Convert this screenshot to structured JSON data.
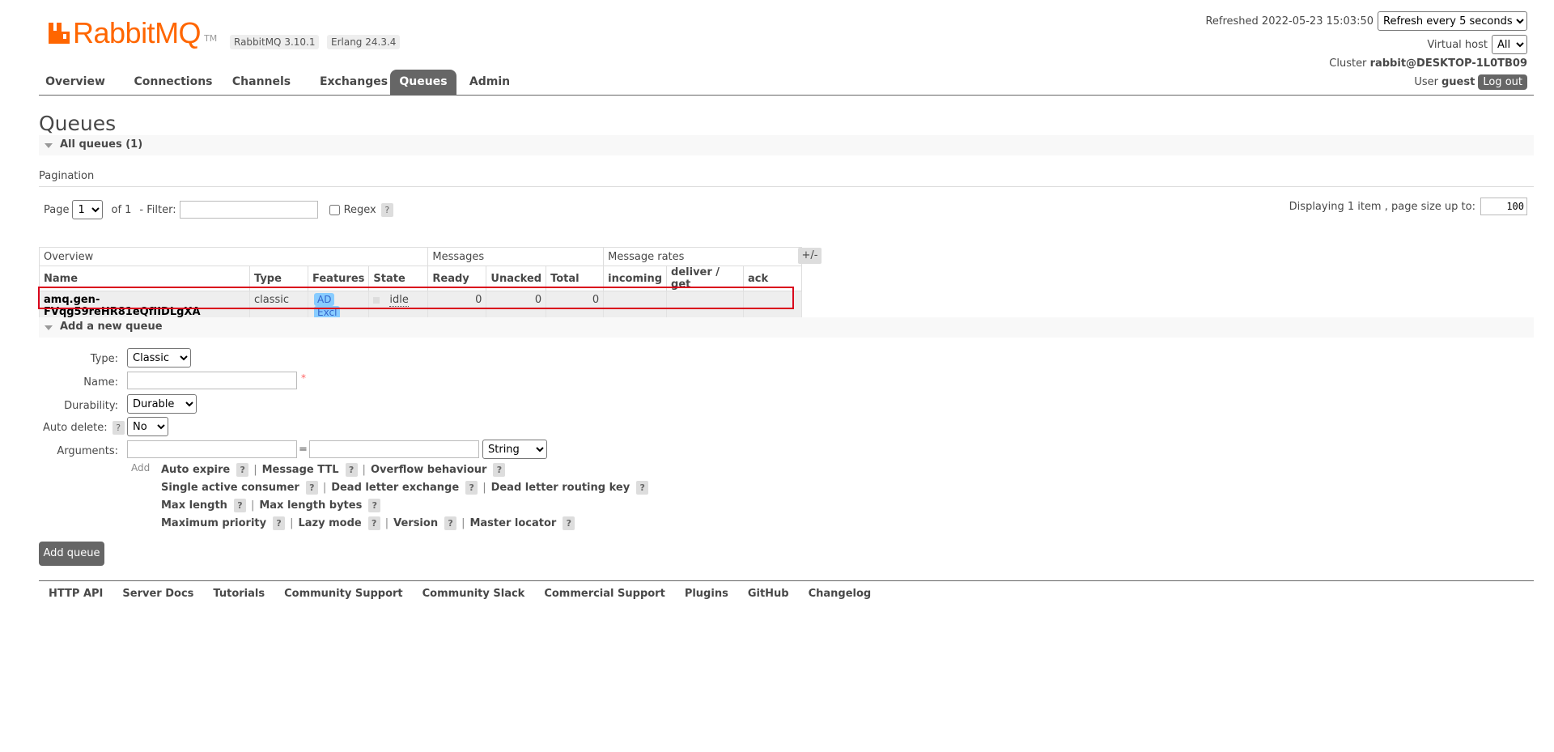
{
  "header": {
    "brand": "RabbitMQ",
    "brand_tm": "TM",
    "version_badge": "RabbitMQ 3.10.1",
    "erlang_badge": "Erlang 24.3.4",
    "refreshed_label": "Refreshed 2022-05-23 15:03:50",
    "refresh_select": "Refresh every 5 seconds",
    "virtual_host_label": "Virtual host",
    "virtual_host_value": "All",
    "cluster_label": "Cluster",
    "cluster_value": "rabbit@DESKTOP-1L0TB09",
    "user_label": "User",
    "user_value": "guest",
    "logout_label": "Log out"
  },
  "tabs": [
    {
      "label": "Overview"
    },
    {
      "label": "Connections"
    },
    {
      "label": "Channels"
    },
    {
      "label": "Exchanges"
    },
    {
      "label": "Queues",
      "active": true
    },
    {
      "label": "Admin"
    }
  ],
  "page_title": "Queues",
  "all_queues_section": "All queues (1)",
  "pagination": {
    "heading": "Pagination",
    "page_label": "Page",
    "page_value": "1",
    "of_label": "of 1",
    "filter_label": "- Filter:",
    "filter_value": "",
    "regex_label": "Regex",
    "help": "?",
    "displaying_label": "Displaying 1 item , page size up to:",
    "page_size": "100"
  },
  "table": {
    "groups": {
      "overview": "Overview",
      "messages": "Messages",
      "rates": "Message rates"
    },
    "columns": {
      "name": "Name",
      "type": "Type",
      "features": "Features",
      "state": "State",
      "ready": "Ready",
      "unacked": "Unacked",
      "total": "Total",
      "incoming": "incoming",
      "deliver_get": "deliver / get",
      "ack": "ack"
    },
    "plus_minus": "+/-",
    "rows": [
      {
        "name": "amq.gen-FVqg59reHR81eQfIIDLgXA",
        "type": "classic",
        "feature_ad": "AD",
        "feature_excl": "Excl",
        "state": "idle",
        "ready": "0",
        "unacked": "0",
        "total": "0",
        "incoming": "",
        "deliver_get": "",
        "ack": ""
      }
    ]
  },
  "add_queue_section": "Add a new queue",
  "form": {
    "type_label": "Type:",
    "type_value": "Classic",
    "name_label": "Name:",
    "name_value": "",
    "required_mark": "*",
    "durability_label": "Durability:",
    "durability_value": "Durable",
    "auto_delete_label": "Auto delete:",
    "auto_delete_value": "No",
    "arguments_label": "Arguments:",
    "equals": "=",
    "arg_type_value": "String",
    "add_label": "Add",
    "arg_options": {
      "auto_expire": "Auto expire",
      "message_ttl": "Message TTL",
      "overflow_behaviour": "Overflow behaviour",
      "single_active_consumer": "Single active consumer",
      "dead_letter_exchange": "Dead letter exchange",
      "dead_letter_routing_key": "Dead letter routing key",
      "max_length": "Max length",
      "max_length_bytes": "Max length bytes",
      "maximum_priority": "Maximum priority",
      "lazy_mode": "Lazy mode",
      "version": "Version",
      "master_locator": "Master locator"
    },
    "separator": "|",
    "submit_label": "Add queue"
  },
  "footer": {
    "links": [
      "HTTP API",
      "Server Docs",
      "Tutorials",
      "Community Support",
      "Community Slack",
      "Commercial Support",
      "Plugins",
      "GitHub",
      "Changelog"
    ]
  },
  "colors": {
    "brand_orange": "#ff6600",
    "tab_active": "#666666",
    "highlight_border": "#d9001b",
    "feature_tag": "#88ccff"
  }
}
